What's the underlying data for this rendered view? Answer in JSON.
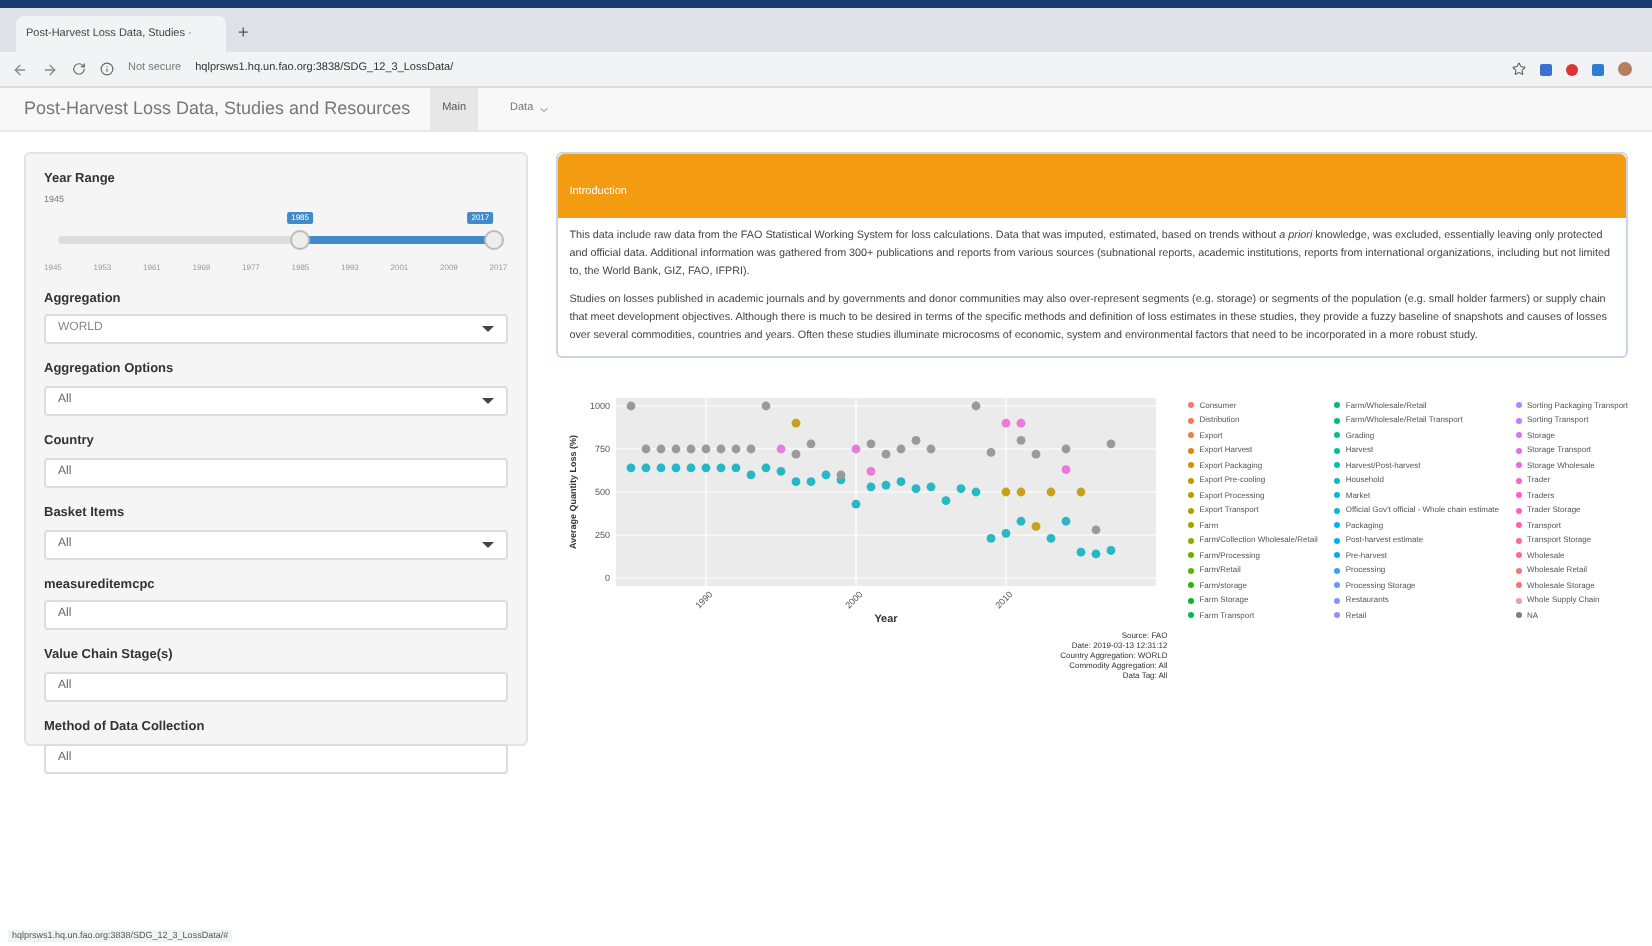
{
  "browser": {
    "tab_title": "Post-Harvest Loss Data, Studies ·",
    "new_tab": "+",
    "security": "Not secure",
    "address": "hqlprsws1.hq.un.fao.org:3838/SDG_12_3_LossData/"
  },
  "navbar": {
    "brand": "Post-Harvest Loss Data, Studies and Resources",
    "items": [
      {
        "label": "Main",
        "selected": true,
        "dropdown": false
      },
      {
        "label": "Data",
        "selected": false,
        "dropdown": true
      }
    ]
  },
  "sidebar": {
    "year_range": {
      "label": "Year Range",
      "min_label": "1945",
      "from": {
        "label": "1985",
        "level": 0.556
      },
      "to": {
        "label": "2017",
        "level": 1
      },
      "ticks": [
        "1945",
        "1953",
        "1961",
        "1969",
        "1977",
        "1985",
        "1993",
        "2001",
        "2009",
        "2017"
      ]
    },
    "fields": [
      {
        "label": "Aggregation",
        "value": "WORLD",
        "kind": "select"
      },
      {
        "label": "Aggregation Options",
        "value": "All",
        "kind": "select"
      },
      {
        "label": "Country",
        "value": "All",
        "kind": "input"
      },
      {
        "label": "Basket Items",
        "value": "All",
        "kind": "select"
      },
      {
        "label": "measureditemcpc",
        "value": "All",
        "kind": "input"
      },
      {
        "label": "Value Chain Stage(s)",
        "value": "All",
        "kind": "input"
      },
      {
        "label": "Method of Data Collection",
        "value": "All",
        "kind": "input"
      }
    ]
  },
  "introduction": {
    "title": "Introduction",
    "paragraphs": [
      "This data include raw data from the FAO Statistical Working System for loss calculations. Data that was imputed, estimated, based on trends without *a priori* knowledge, was excluded, essentially leaving only protected and official data. Additional information was gathered from 300+ publications and reports from various sources (subnational reports, academic institutions, reports from international organizations, including but not limited to, the World Bank, GIZ, FAO, IFPRI).",
      "Studies on losses published in academic journals and by governments and donor communities may also over-represent segments (e.g. storage) or segments of the population (e.g. small holder farmers) or supply chain that meet development objectives. Although there is much to be desired in terms of the specific methods and definition of loss estimates in these studies, they provide a fuzzy baseline of snapshots and causes of losses over several commodities, countries and years. Often these studies illuminate microcosms of economic, system and environmental factors that need to be incorporated in a more robust study."
    ]
  },
  "plot": {
    "chart_data": {
      "type": "scatter",
      "xlabel": "Year",
      "ylabel": "Average Quantity Loss (%)",
      "x": [
        1985,
        1986,
        1987,
        1988,
        1989,
        1990,
        1991,
        1992,
        1993,
        1994,
        1995,
        1996,
        1997,
        1998,
        1999,
        2000,
        2001,
        2002,
        2003,
        2004,
        2005,
        2006,
        2007,
        2008,
        2009,
        2010,
        2011,
        2012,
        2013,
        2014,
        2015,
        2016,
        2017
      ],
      "xlim": [
        1984,
        2020
      ],
      "ylim": [
        0,
        1000
      ],
      "xticks": [
        1990,
        2000,
        2010
      ],
      "grid": true,
      "yticks": [
        0,
        250,
        500,
        750,
        1000
      ],
      "series": [
        {
          "color": "#26b8c4",
          "values": [
            640,
            640,
            640,
            640,
            640,
            640,
            640,
            640,
            600,
            640,
            620,
            560,
            560,
            600,
            570,
            430,
            530,
            540,
            560,
            520,
            530,
            450,
            520,
            500,
            230,
            260,
            330,
            null,
            230,
            330,
            150,
            140,
            160
          ]
        },
        {
          "color": "#9a9a9a",
          "values": [
            1000,
            750,
            750,
            750,
            750,
            750,
            750,
            750,
            750,
            1000,
            null,
            720,
            780,
            null,
            600,
            null,
            780,
            720,
            750,
            800,
            750,
            null,
            null,
            1000,
            730,
            null,
            800,
            720,
            null,
            750,
            null,
            280,
            780
          ]
        },
        {
          "color": "#e87ad8",
          "values": [
            null,
            null,
            null,
            null,
            null,
            null,
            null,
            null,
            null,
            null,
            750,
            null,
            null,
            null,
            null,
            750,
            620,
            null,
            null,
            null,
            null,
            null,
            null,
            null,
            null,
            900,
            900,
            null,
            null,
            630,
            null,
            null,
            null
          ]
        },
        {
          "color": "#c8a020",
          "values": [
            null,
            null,
            null,
            null,
            null,
            null,
            null,
            null,
            null,
            null,
            null,
            900,
            null,
            null,
            null,
            null,
            null,
            null,
            null,
            null,
            null,
            null,
            null,
            null,
            null,
            500,
            500,
            300,
            500,
            null,
            500,
            null,
            null
          ]
        }
      ]
    },
    "caption": [
      "Source: FAO",
      "Date: 2019-03-13 12:31:12",
      "Country Aggregation: WORLD",
      "Commodity Aggregation: All",
      "Data Tag: All"
    ],
    "legend": [
      {
        "label": "Consumer",
        "color": "#f8766d"
      },
      {
        "label": "Distribution",
        "color": "#f47d4b"
      },
      {
        "label": "Export",
        "color": "#ed8141"
      },
      {
        "label": "Export Harvest",
        "color": "#e38900"
      },
      {
        "label": "Export Packaging",
        "color": "#d89000"
      },
      {
        "label": "Export Pre-cooling",
        "color": "#cb9600"
      },
      {
        "label": "Export Processing",
        "color": "#bd9c00"
      },
      {
        "label": "Export Transport",
        "color": "#ada200"
      },
      {
        "label": "Farm",
        "color": "#9ca700"
      },
      {
        "label": "Farm/Collection Wholesale/Retail",
        "color": "#88ac00"
      },
      {
        "label": "Farm/Processing",
        "color": "#72b000"
      },
      {
        "label": "Farm/Retail",
        "color": "#57b400"
      },
      {
        "label": "Farm/storage",
        "color": "#2bb600"
      },
      {
        "label": "Farm Storage",
        "color": "#00b92e"
      },
      {
        "label": "Farm Transport",
        "color": "#00bb4e"
      },
      {
        "label": "Farm/Wholesale/Retail",
        "color": "#00bd65"
      },
      {
        "label": "Farm/Wholesale/Retail Transport",
        "color": "#00be7a"
      },
      {
        "label": "Grading",
        "color": "#00bf8d"
      },
      {
        "label": "Harvest",
        "color": "#00c09f"
      },
      {
        "label": "Harvest/Post-harvest",
        "color": "#00c0b0"
      },
      {
        "label": "Household",
        "color": "#00bfc0"
      },
      {
        "label": "Market",
        "color": "#00bdd0"
      },
      {
        "label": "Official Gov't official - Whole chain estimate",
        "color": "#00badf"
      },
      {
        "label": "Packaging",
        "color": "#00b6eb"
      },
      {
        "label": "Post-harvest estimate",
        "color": "#00b0f6"
      },
      {
        "label": "Pre-harvest",
        "color": "#00a9ff"
      },
      {
        "label": "Processing",
        "color": "#35a2ff"
      },
      {
        "label": "Processing Storage",
        "color": "#619cff"
      },
      {
        "label": "Restaurants",
        "color": "#8195ff"
      },
      {
        "label": "Retail",
        "color": "#9c8dff"
      },
      {
        "label": "Sorting Packaging Transport",
        "color": "#b385ff"
      },
      {
        "label": "Sorting Transport",
        "color": "#c77cff"
      },
      {
        "label": "Storage",
        "color": "#d874fd"
      },
      {
        "label": "Storage Transport",
        "color": "#e76bf3"
      },
      {
        "label": "Storage Wholesale",
        "color": "#f265e7"
      },
      {
        "label": "Trader",
        "color": "#fa62da"
      },
      {
        "label": "Traders",
        "color": "#ff61cc"
      },
      {
        "label": "Trader Storage",
        "color": "#ff62bc"
      },
      {
        "label": "Transport",
        "color": "#ff65ac"
      },
      {
        "label": "Transport Storage",
        "color": "#ff699b"
      },
      {
        "label": "Wholesale",
        "color": "#fd6e89"
      },
      {
        "label": "Wholesale Retail",
        "color": "#fa7378"
      },
      {
        "label": "Wholesale Storage",
        "color": "#f8766d"
      },
      {
        "label": "Whole Supply Chain",
        "color": "#e9a0a0"
      },
      {
        "label": "NA",
        "color": "#7f7f7f"
      }
    ]
  },
  "status_bar": {
    "url": "hqlprsws1.hq.un.fao.org:3838/SDG_12_3_LossData/#"
  }
}
